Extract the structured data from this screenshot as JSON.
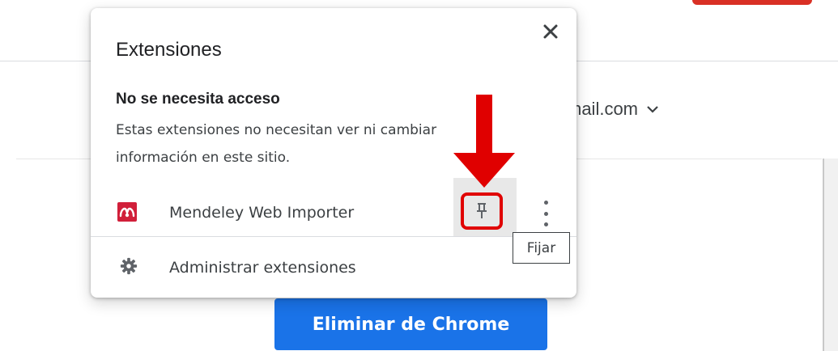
{
  "page": {
    "account_suffix": "mail.com",
    "remove_button": "Eliminar de Chrome"
  },
  "popup": {
    "title": "Extensiones",
    "close_icon": "close-icon",
    "section_title": "No se necesita acceso",
    "section_desc": "Estas extensiones no necesitan ver ni cambiar información en este sitio.",
    "extensions": [
      {
        "name": "Mendeley Web Importer",
        "icon": "mendeley-icon",
        "pin_icon": "pin-icon",
        "menu_icon": "more-vert-icon"
      }
    ],
    "manage_label": "Administrar extensiones",
    "manage_icon": "gear-icon"
  },
  "tooltip": {
    "text": "Fijar"
  },
  "colors": {
    "accent": "#1a73e8",
    "annotation_red": "#e00000",
    "extension_brand": "#d11f3a"
  }
}
